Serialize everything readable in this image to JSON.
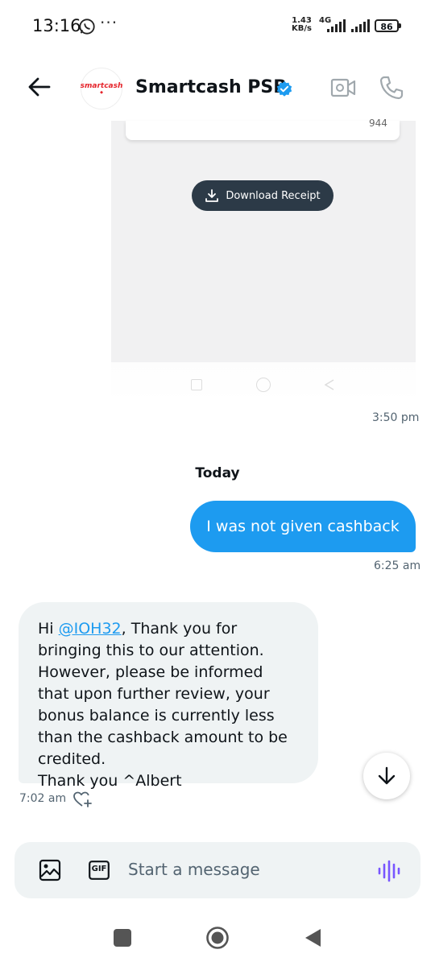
{
  "status_bar": {
    "time": "13:16",
    "more": "···",
    "net_speed_value": "1.43",
    "net_speed_unit": "KB/s",
    "network": "4G",
    "battery": "86"
  },
  "header": {
    "avatar_text": "smartcash",
    "contact_name": "Smartcash PSB"
  },
  "attachment": {
    "receipt_value": "944",
    "download_label": "Download Receipt"
  },
  "messages": {
    "attachment_time": "3:50 pm",
    "day_separator": "Today",
    "outgoing_text": "I was not given cashback",
    "outgoing_time": "6:25 am",
    "incoming_prefix": "Hi ",
    "incoming_mention": "@IOH32",
    "incoming_body": ", Thank you for bringing this to our attention. However, please be informed that upon further review, your bonus balance is currently less than the cashback amount to be credited.",
    "incoming_signoff": "Thank you ^Albert",
    "incoming_time": "7:02 am"
  },
  "composer": {
    "gif_label": "GIF",
    "placeholder": "Start a message"
  },
  "colors": {
    "accent": "#1d9bf0",
    "voice": "#7856ff",
    "button_dark": "#2c3a47"
  }
}
